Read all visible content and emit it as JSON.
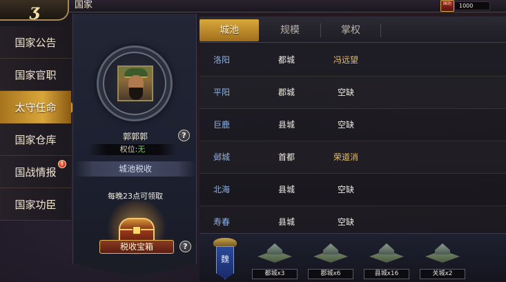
{
  "top": {
    "title": "国家",
    "resource_icon_text": "国功",
    "resource_value": "1000"
  },
  "menu": [
    {
      "label": "国家公告",
      "active": false,
      "alert": false
    },
    {
      "label": "国家官职",
      "active": false,
      "alert": false
    },
    {
      "label": "太守任命",
      "active": true,
      "alert": false
    },
    {
      "label": "国家仓库",
      "active": false,
      "alert": false
    },
    {
      "label": "国战情报",
      "active": false,
      "alert": true
    },
    {
      "label": "国家功臣",
      "active": false,
      "alert": false
    }
  ],
  "alert_glyph": "!",
  "hero": {
    "name": "郭郭郭",
    "rank_label": "权位:",
    "rank_value": "无"
  },
  "help_glyph": "?",
  "tax": {
    "banner": "城池税收",
    "note": "每晚23点可领取",
    "chest_button": "税收宝箱"
  },
  "tabs": [
    {
      "label": "城池",
      "active": true
    },
    {
      "label": "规模",
      "active": false
    },
    {
      "label": "掌权",
      "active": false
    }
  ],
  "cities": [
    {
      "name": "洛阳",
      "type": "都城",
      "governor": "冯远望",
      "vacant": false
    },
    {
      "name": "平阳",
      "type": "郡城",
      "governor": "空缺",
      "vacant": true
    },
    {
      "name": "巨鹿",
      "type": "县城",
      "governor": "空缺",
      "vacant": true
    },
    {
      "name": "邺城",
      "type": "首都",
      "governor": "荣道消",
      "vacant": false
    },
    {
      "name": "北海",
      "type": "县城",
      "governor": "空缺",
      "vacant": true
    },
    {
      "name": "寿春",
      "type": "县城",
      "governor": "空缺",
      "vacant": true
    }
  ],
  "kingdom": {
    "name": "魏"
  },
  "holdings": [
    {
      "label": "都城x3"
    },
    {
      "label": "郡城x6"
    },
    {
      "label": "县城x16"
    },
    {
      "label": "关城x2"
    }
  ],
  "colors": {
    "accent_gold": "#d9a83c",
    "city_name_blue": "#8fb2e2",
    "governor_gold": "#e8c268",
    "rank_green": "#5ddc3a"
  }
}
